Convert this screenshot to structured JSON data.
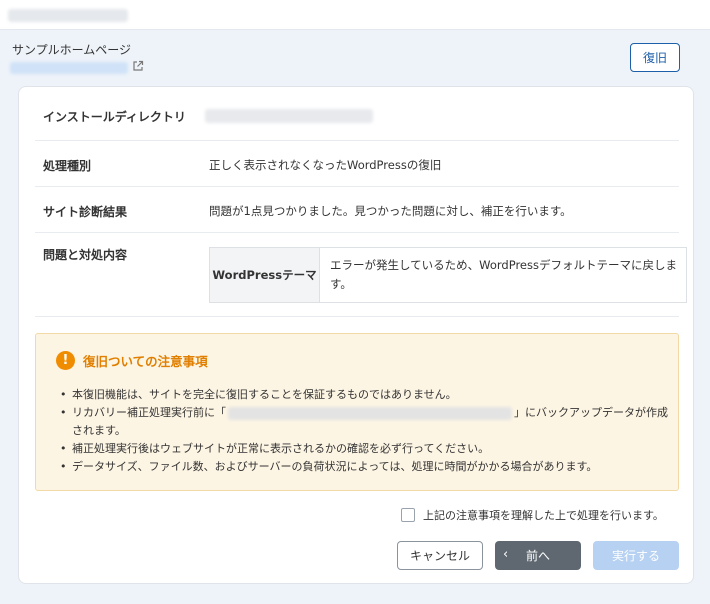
{
  "header": {
    "site_name": "サンプルホームページ",
    "restore_label": "復旧"
  },
  "details": {
    "install_dir_label": "インストールディレクトリ",
    "process_type_label": "処理種別",
    "process_type_value": "正しく表示されなくなったWordPressの復旧",
    "diagnosis_label": "サイト診断結果",
    "diagnosis_value": "問題が1点見つかりました。見つかった問題に対し、補正を行います。",
    "issues_label": "問題と対処内容",
    "issue_name": "WordPressテーマ",
    "issue_desc": "エラーが発生しているため、WordPressデフォルトテーマに戻します。"
  },
  "notice": {
    "title": "復旧ついての注意事項",
    "item1": "本復旧機能は、サイトを完全に復旧することを保証するものではありません。",
    "item2_pre": "リカバリー補正処理実行前に「",
    "item2_post": "」にバックアップデータが作成されます。",
    "item3": "補正処理実行後はウェブサイトが正常に表示されるかの確認を必ず行ってください。",
    "item4": "データサイズ、ファイル数、およびサーバーの負荷状況によっては、処理に時間がかかる場合があります。"
  },
  "agree_label": "上記の注意事項を理解した上で処理を行います。",
  "buttons": {
    "cancel": "キャンセル",
    "prev": "前へ",
    "run": "実行する"
  },
  "colors": {
    "accent": "#1d5fa8",
    "warning": "#f08c00",
    "notice_bg": "#fdf5e4",
    "run_disabled": "#b6d1f1"
  }
}
